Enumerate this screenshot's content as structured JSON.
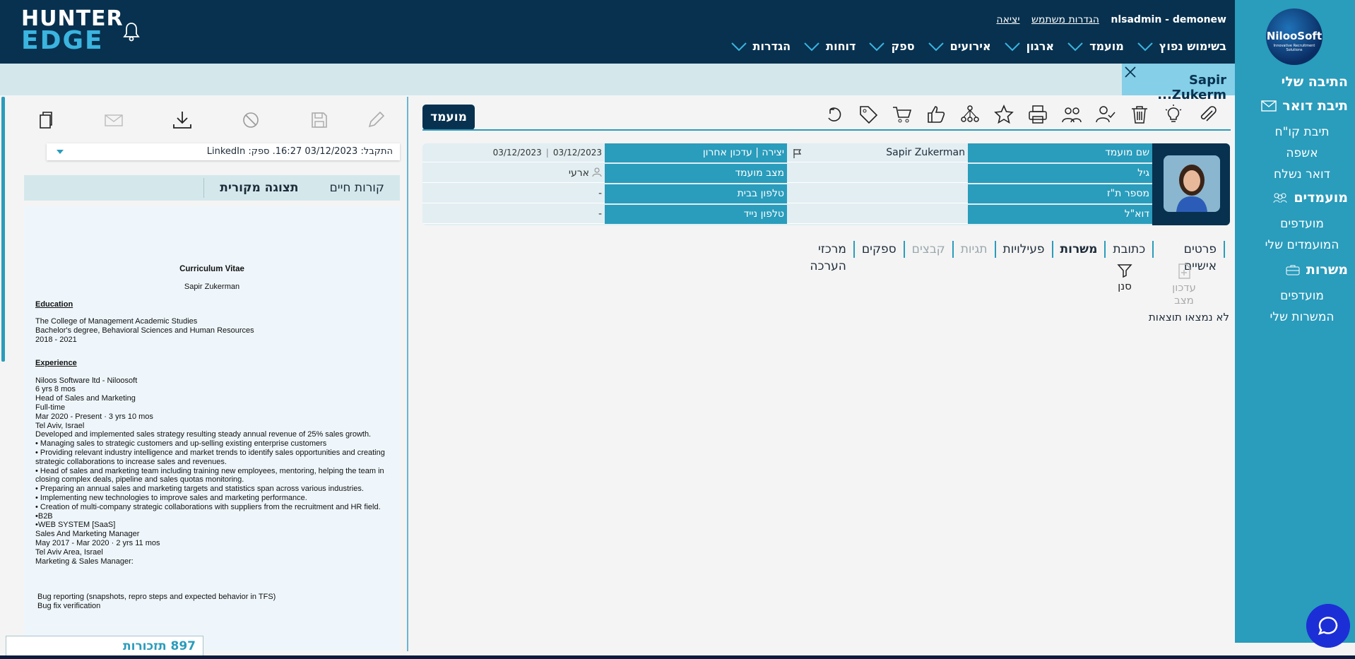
{
  "header": {
    "logo_line1": "HUNTER",
    "logo_line2": "EDGE",
    "user": "nlsadmin - demonew",
    "user_settings": "הגדרות משתמש",
    "logout": "יציאה",
    "menu": [
      "בשימוש נפוץ",
      "מועמד",
      "ארגון",
      "אירועים",
      "ספק",
      "דוחות",
      "הגדרות"
    ]
  },
  "sidebar": {
    "logo": "NilooSoft",
    "logo_tagline": "Innovative Recruitment Solutions",
    "my_box": "התיבה שלי",
    "mail_box": "תיבת דואר",
    "mail_items": [
      "תיבת קו\"ח",
      "אשפה",
      "דואר נשלח"
    ],
    "candidates": "מועמדים",
    "candidate_items": [
      "מועדפים",
      "המועמדים שלי"
    ],
    "jobs": "משרות",
    "job_items": [
      "מועדפים",
      "המשרות שלי"
    ]
  },
  "banner": {
    "tab_title": "Sapir Zukerm..."
  },
  "left": {
    "source": "התקבל: 03/12/2023 16:27. ספק: LinkedIn",
    "tabs": [
      "קורות חיים",
      "תצוגה מקורית"
    ],
    "notes": "897 תזכורות"
  },
  "cv": {
    "title": "Curriculum Vitae",
    "name": "Sapir Zukerman",
    "education_h": "Education",
    "education": [
      "The College of Management Academic Studies",
      "Bachelor's degree, Behavioral Sciences and Human Resources",
      "2018 - 2021"
    ],
    "experience_h": "Experience",
    "experience": [
      "Niloos Software ltd - Niloosoft",
      "6 yrs 8 mos",
      "Head of Sales and Marketing",
      "Full-time",
      "Mar 2020 - Present · 3 yrs 10 mos",
      "Tel Aviv, Israel",
      "Developed and implemented sales strategy resulting steady annual revenue of 25% sales growth.",
      "• Managing sales to strategic customers and up-selling existing enterprise customers",
      "• Providing relevant industry intelligence and market trends to identify sales opportunities and creating strategic collaborations to increase sales and revenues.",
      "• Head of sales and marketing team including training new employees, mentoring, helping the team in closing complex deals, pipeline and sales quotas monitoring.",
      "• Preparing an annual sales and marketing targets and statistics span across various industries.",
      "• Implementing new technologies to improve sales and marketing performance.",
      "• Creation of multi-company strategic collaborations with suppliers from the recruitment and HR field.",
      "•B2B",
      "•WEB SYSTEM [SaaS]",
      "Sales And Marketing Manager",
      "May 2017 - Mar 2020 · 2 yrs 11 mos",
      "Tel Aviv Area, Israel",
      "Marketing & Sales Manager:"
    ],
    "extra": [
      "Bug reporting (snapshots, repro steps and expected behavior in TFS)",
      "Bug fix verification"
    ]
  },
  "candidate": {
    "button": "מועמד",
    "labels": {
      "name": "שם מועמד",
      "age": "גיל",
      "id": "מספר ת\"ז",
      "email": "דוא\"ל",
      "created": "יצירה | עדכון אחרון",
      "status": "מצב מועמד",
      "home_phone": "טלפון בבית",
      "mobile": "טלפון נייד"
    },
    "values": {
      "name": "Sapir Zukerman",
      "created": "03/12/2023",
      "updated": "03/12/2023",
      "status": "ארעי",
      "home_phone": "-",
      "mobile": "-"
    }
  },
  "tabs": [
    "פרטים אישיים",
    "כתובת",
    "משרות",
    "פעילויות",
    "תגיות",
    "קבצים",
    "ספקים",
    "מרכזי הערכה"
  ],
  "actions": {
    "update_status": "עדכון מצב",
    "filter": "סנן"
  },
  "no_results": "לא נמצאו תוצאות",
  "colors": {
    "navy": "#07314f",
    "teal": "#2a9cbc",
    "light": "#d4e8ec"
  }
}
